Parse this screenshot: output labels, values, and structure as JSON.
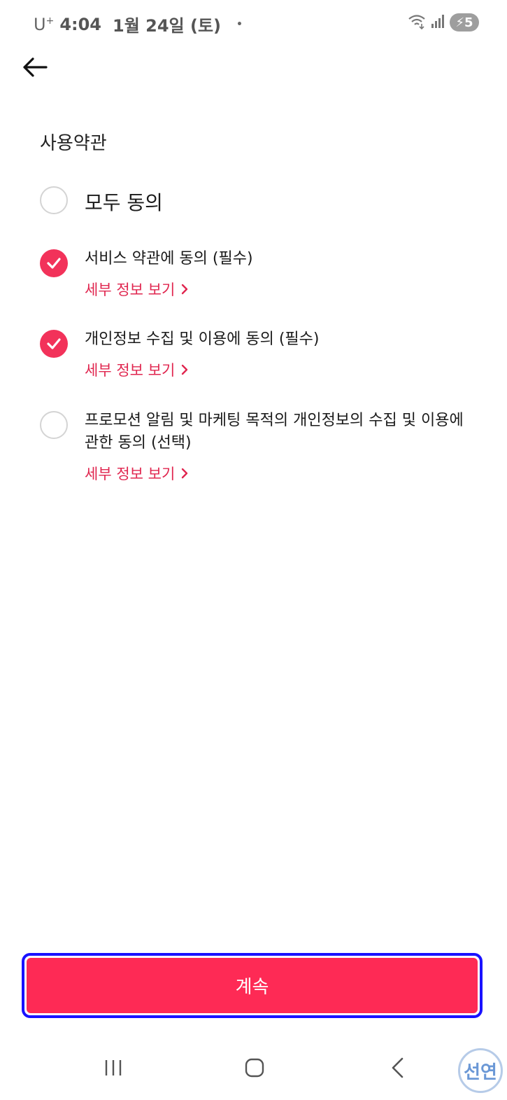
{
  "status_bar": {
    "carrier": "U",
    "carrier_sup": "+",
    "time": "4:04",
    "date": "1월 24일 (토)",
    "dot": "•",
    "battery": "5"
  },
  "page": {
    "title": "사용약관"
  },
  "agree_all": {
    "label": "모두 동의",
    "checked": false
  },
  "terms": [
    {
      "label": "서비스 약관에 동의 (필수)",
      "checked": true,
      "detail_label": "세부 정보 보기"
    },
    {
      "label": "개인정보 수집 및 이용에 동의 (필수)",
      "checked": true,
      "detail_label": "세부 정보 보기"
    },
    {
      "label": "프로모션 알림 및 마케팅 목적의 개인정보의 수집 및 이용에 관한 동의 (선택)",
      "checked": false,
      "detail_label": "세부 정보 보기"
    }
  ],
  "continue_button": {
    "label": "계속"
  },
  "watermark": {
    "text": "선연"
  },
  "colors": {
    "accent": "#fe2a55",
    "link": "#e0264f",
    "highlight_border": "#1a12ff"
  },
  "icons": {
    "back": "arrow-left-icon",
    "check": "check-icon",
    "chevron": "chevron-right-icon"
  }
}
